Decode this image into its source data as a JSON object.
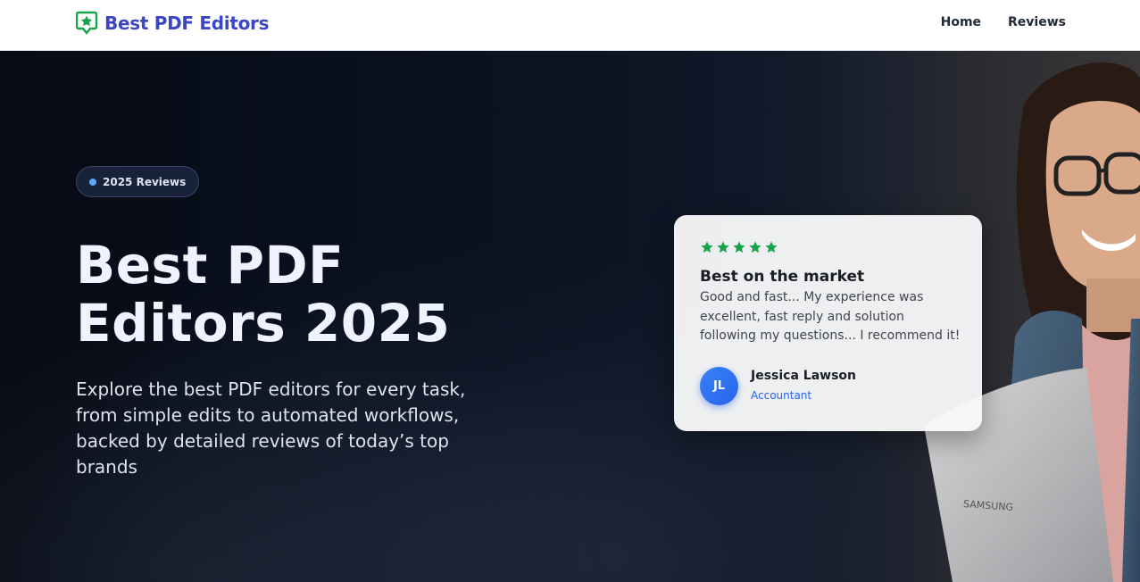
{
  "header": {
    "logo_text": "Best PDF Editors",
    "logo_icon": "star-badge-icon",
    "nav": [
      {
        "label": "Home"
      },
      {
        "label": "Reviews"
      }
    ]
  },
  "hero": {
    "badge": "2025 Reviews",
    "title_line1": "Best PDF",
    "title_line2": "Editors 2025",
    "subtitle": "Explore the best PDF editors for every task, from simple edits to automated workflows, backed by detailed reviews of today’s top brands"
  },
  "review": {
    "rating": 5,
    "max_rating": 5,
    "title": "Best on the market",
    "text": "Good and fast... My experience was excellent, fast reply and solution following my questions... I recommend it!",
    "avatar_initials": "JL",
    "name": "Jessica Lawson",
    "role": "Accountant"
  },
  "colors": {
    "brand": "#3b46c4",
    "star": "#16a34a",
    "accent": "#2563eb",
    "hero_bg": "#0a1120"
  }
}
